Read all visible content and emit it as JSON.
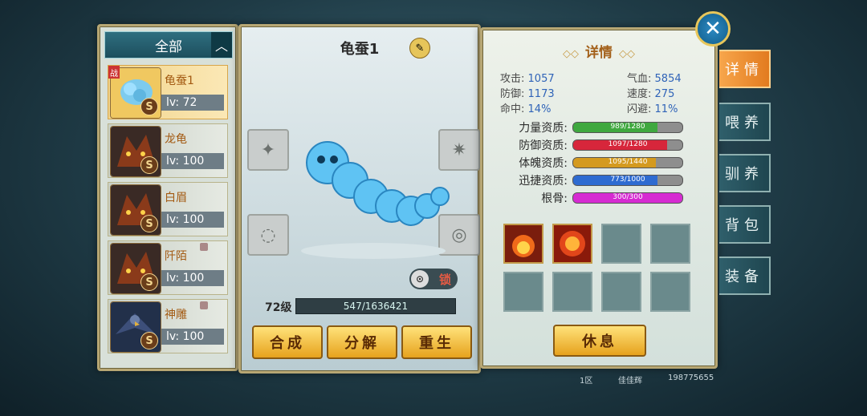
{
  "filter": {
    "label": "全部",
    "collapse_icon": "︿"
  },
  "pets": [
    {
      "name": "龟蚕1",
      "level": "lv: 72",
      "rank": "S",
      "selected": true,
      "war": "战"
    },
    {
      "name": "龙龟",
      "level": "lv: 100",
      "rank": "S"
    },
    {
      "name": "白眉",
      "level": "lv: 100",
      "rank": "S"
    },
    {
      "name": "阡陌",
      "level": "lv: 100",
      "rank": "S"
    },
    {
      "name": "神雕",
      "level": "lv: 100",
      "rank": "S"
    }
  ],
  "pet_detail": {
    "name": "龟蚕1",
    "lock_label": "锁",
    "level_label": "72级",
    "exp": "547/1636421",
    "actions": {
      "compose": "合成",
      "decompose": "分解",
      "rebirth": "重生"
    }
  },
  "details": {
    "title": "详情",
    "stats": {
      "attack_label": "攻击:",
      "attack": "1057",
      "hp_label": "气血:",
      "hp": "5854",
      "defense_label": "防御:",
      "defense": "1173",
      "speed_label": "速度:",
      "speed": "275",
      "hit_label": "命中:",
      "hit": "14%",
      "dodge_label": "闪避:",
      "dodge": "11%"
    },
    "aptitudes": [
      {
        "label": "力量资质:",
        "text": "989/1280",
        "fraction": 0.773,
        "color": "#3fa83f"
      },
      {
        "label": "防御资质:",
        "text": "1097/1280",
        "fraction": 0.857,
        "color": "#d7263b"
      },
      {
        "label": "体魄资质:",
        "text": "1095/1440",
        "fraction": 0.76,
        "color": "#d49a1f"
      },
      {
        "label": "迅捷资质:",
        "text": "773/1000",
        "fraction": 0.773,
        "color": "#2e6bd1"
      },
      {
        "label": "根骨:",
        "text": "300/300",
        "fraction": 1.0,
        "color": "#d62bd2"
      }
    ],
    "rest_label": "休息"
  },
  "tabs": [
    {
      "label": "详情",
      "active": true
    },
    {
      "label": "喂养"
    },
    {
      "label": "驯养"
    },
    {
      "label": "背包"
    },
    {
      "label": "装备"
    }
  ],
  "footer": {
    "server": "1区",
    "player": "佳佳辉",
    "id": "198775655"
  },
  "icons": {
    "close": "close-icon",
    "edit": "edit-icon",
    "lock": "lock-icon"
  }
}
